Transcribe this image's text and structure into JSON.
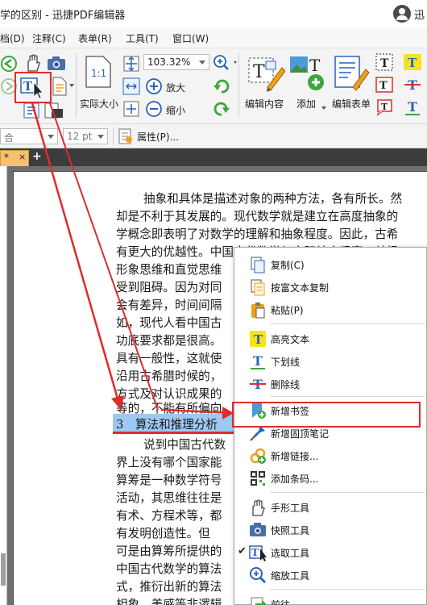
{
  "window": {
    "title": "学的区别  -  迅捷PDF编辑器",
    "user_name": "迅"
  },
  "menubar": {
    "items": [
      "档(D)",
      "注释(C)",
      "表单(R)",
      "工具(T)",
      "窗口(W)"
    ]
  },
  "ribbon": {
    "zoom_value": "103.32%",
    "actual_size_label": "实际大小",
    "zoom_in_label": "放大",
    "zoom_out_label": "缩小",
    "edit_content_label": "编辑内容",
    "add_label": "添加",
    "edit_form_label": "编辑表单"
  },
  "propbar": {
    "font_value": "合",
    "font_size_value": "12 pt",
    "properties_label": "属性(P)..."
  },
  "tabs": {
    "active_tab_label": "*",
    "close_glyph": "×",
    "add_glyph": "+"
  },
  "document": {
    "lines": [
      "抽象和具体是描述对象的两种方法，各有所长。然",
      "却是不利于其发展的。现代数学就是建立在高度抽象的",
      "学概念即表明了对数学的理解和抽象程度。因此，古希",
      "有更大的优越性。中国古代数学与实际结合紧密，其根",
      "形象思维和直觉思维",
      "受到阻碍。因为对同",
      "会有差异，时间间隔",
      "如，现代人看中国古",
      "功底要求都是很高。",
      "具有一般性，这就使",
      "沿用古希腊时候的，",
      "方式及对认识成果的",
      "等的，不能有所偏向",
      "说到中国古代数",
      "界上没有哪个国家能",
      "算筹是一种数学符号",
      "活动，其思维往往是",
      "有术、方程术等，都",
      "有发明创造性。但",
      "可是由算筹所提供的",
      "中国古代数学的算法",
      "式，推衍出新的算法",
      "相象、美感等非逻辑"
    ],
    "selected_line": "3　算法和推理分析"
  },
  "context_menu": {
    "items": [
      {
        "label": "复制(C)",
        "icon": "copy-icon"
      },
      {
        "label": "按富文本复制",
        "icon": "rich-copy-icon"
      },
      {
        "label": "粘贴(P)",
        "icon": "paste-icon"
      },
      {
        "label": "高亮文本",
        "icon": "highlight-icon"
      },
      {
        "label": "下划线",
        "icon": "underline-icon"
      },
      {
        "label": "删除线",
        "icon": "strikethrough-icon"
      },
      {
        "label": "新增书签",
        "icon": "bookmark-icon"
      },
      {
        "label": "新增固顶笔记",
        "icon": "pin-note-icon"
      },
      {
        "label": "新增链接...",
        "icon": "link-icon"
      },
      {
        "label": "添加条码...",
        "icon": "barcode-icon"
      },
      {
        "label": "手形工具",
        "icon": "hand-icon"
      },
      {
        "label": "快照工具",
        "icon": "camera-icon"
      },
      {
        "label": "选取工具",
        "icon": "select-tool-icon",
        "checked": true
      },
      {
        "label": "缩放工具",
        "icon": "zoom-tool-icon"
      },
      {
        "label": "前往",
        "icon": "goto-icon"
      }
    ],
    "check_glyph": "✔"
  },
  "colors": {
    "annotation_red": "#e02b2b",
    "selection_blue": "#9cc8f2",
    "tab_orange": "#f5c26b"
  }
}
